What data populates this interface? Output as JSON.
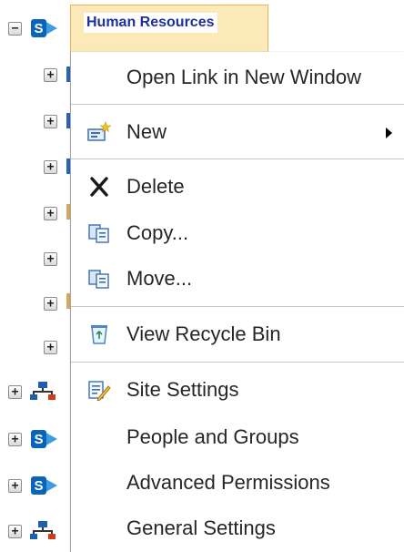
{
  "tree": {
    "root": {
      "label": "Human Resources",
      "toggle": "⊟"
    },
    "child_toggle": "+"
  },
  "menu": {
    "items": [
      {
        "label": "Open Link in New Window"
      },
      {
        "label": "New",
        "icon": "new-item-icon",
        "has_submenu": true
      },
      {
        "label": "Delete",
        "icon": "delete-x-icon"
      },
      {
        "label": "Copy...",
        "icon": "copy-icon"
      },
      {
        "label": "Move...",
        "icon": "move-icon"
      },
      {
        "label": "View Recycle Bin",
        "icon": "recycle-bin-icon"
      },
      {
        "label": "Site Settings",
        "icon": "site-settings-icon"
      },
      {
        "label": "People and Groups"
      },
      {
        "label": "Advanced Permissions"
      },
      {
        "label": "General Settings"
      }
    ]
  },
  "colors": {
    "selection_fill": "#fce9b8",
    "selection_border": "#f0b15a",
    "link_blue": "#1e2f9e",
    "sharepoint_blue": "#0a64b8"
  }
}
